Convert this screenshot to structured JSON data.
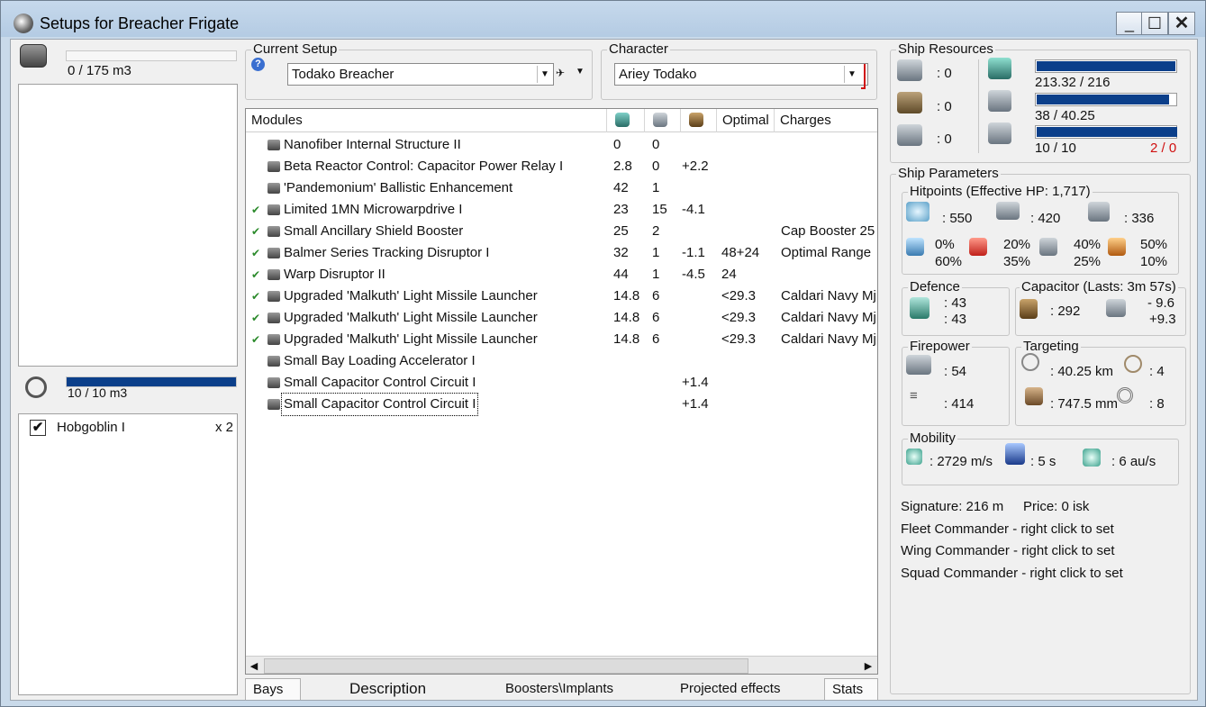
{
  "window": {
    "title": "Setups for Breacher Frigate",
    "minimize": "_",
    "maximize": "☐",
    "close": "✕"
  },
  "cargo": {
    "label": "0 / 175 m3",
    "fill": 0
  },
  "drone_bay": {
    "label": "10 / 10 m3",
    "fill": 1.0,
    "drones": [
      {
        "name": "Hobgoblin I",
        "qty": "x 2",
        "checked": "✔"
      }
    ]
  },
  "current_setup": {
    "title": "Current Setup",
    "value": "Todako Breacher",
    "help": "?"
  },
  "character": {
    "title": "Character",
    "value": "Ariey Todako"
  },
  "modules": {
    "headers": [
      "Modules",
      "",
      "",
      "",
      "Optimal",
      "Charges"
    ],
    "rows": [
      {
        "name": "Nanofiber Internal Structure II",
        "active": "",
        "c1": "0",
        "c2": "0",
        "c3": "",
        "c4": "",
        "c5": ""
      },
      {
        "name": "Beta Reactor Control: Capacitor Power Relay I",
        "active": "",
        "c1": "2.8",
        "c2": "0",
        "c3": "+2.2",
        "c4": "",
        "c5": ""
      },
      {
        "name": "'Pandemonium' Ballistic Enhancement",
        "active": "",
        "c1": "42",
        "c2": "1",
        "c3": "",
        "c4": "",
        "c5": ""
      },
      {
        "name": "Limited 1MN Microwarpdrive I",
        "active": "✔",
        "c1": "23",
        "c2": "15",
        "c3": "-4.1",
        "c4": "",
        "c5": ""
      },
      {
        "name": "Small Ancillary Shield Booster",
        "active": "✔",
        "c1": "25",
        "c2": "2",
        "c3": "",
        "c4": "",
        "c5": "Cap Booster 25"
      },
      {
        "name": "Balmer Series Tracking Disruptor I",
        "active": "✔",
        "c1": "32",
        "c2": "1",
        "c3": "-1.1",
        "c4": "48+24",
        "c5": "Optimal Range"
      },
      {
        "name": "Warp Disruptor II",
        "active": "✔",
        "c1": "44",
        "c2": "1",
        "c3": "-4.5",
        "c4": "24",
        "c5": ""
      },
      {
        "name": "Upgraded 'Malkuth' Light Missile Launcher",
        "active": "✔",
        "c1": "14.8",
        "c2": "6",
        "c3": "",
        "c4": "<29.3",
        "c5": "Caldari Navy Mj"
      },
      {
        "name": "Upgraded 'Malkuth' Light Missile Launcher",
        "active": "✔",
        "c1": "14.8",
        "c2": "6",
        "c3": "",
        "c4": "<29.3",
        "c5": "Caldari Navy Mj"
      },
      {
        "name": "Upgraded 'Malkuth' Light Missile Launcher",
        "active": "✔",
        "c1": "14.8",
        "c2": "6",
        "c3": "",
        "c4": "<29.3",
        "c5": "Caldari Navy Mj"
      },
      {
        "name": "Small Bay Loading Accelerator I",
        "active": "",
        "c1": "",
        "c2": "",
        "c3": "",
        "c4": "",
        "c5": ""
      },
      {
        "name": "Small Capacitor Control Circuit I",
        "active": "",
        "c1": "",
        "c2": "",
        "c3": "+1.4",
        "c4": "",
        "c5": ""
      },
      {
        "name": "Small Capacitor Control Circuit I",
        "active": "",
        "c1": "",
        "c2": "",
        "c3": "+1.4",
        "c4": "",
        "c5": ""
      }
    ]
  },
  "tabs": [
    "Bays",
    "Description",
    "Boosters\\Implants",
    "Projected effects",
    "Stats"
  ],
  "ship_resources": {
    "title": "Ship Resources",
    "hardpoints": [
      ": 0",
      ": 0",
      ": 0"
    ],
    "cpu": {
      "label": "213.32 / 216",
      "fill": 0.988
    },
    "powergrid": {
      "label": "38 / 40.25",
      "fill": 0.944
    },
    "calibration": {
      "label": "10 / 10",
      "fill": 1.0,
      "extra": "2 / 0"
    }
  },
  "ship_parameters": {
    "title": "Ship Parameters",
    "hitpoints": {
      "title": "Hitpoints (Effective HP: 1,717)",
      "shield": ": 550",
      "armor": ": 420",
      "structure": ": 336",
      "resists": [
        {
          "top": "0%",
          "bottom": "60%"
        },
        {
          "top": "20%",
          "bottom": "35%"
        },
        {
          "top": "40%",
          "bottom": "25%"
        },
        {
          "top": "50%",
          "bottom": "10%"
        }
      ]
    },
    "defence": {
      "title": "Defence",
      "top": ": 43",
      "bottom": ": 43"
    },
    "capacitor": {
      "title": "Capacitor (Lasts: 3m 57s)",
      "amount": ": 292",
      "delta_top": "- 9.6",
      "delta_bottom": "+9.3"
    },
    "firepower": {
      "title": "Firepower",
      "top": ": 54",
      "bottom": ": 414"
    },
    "targeting": {
      "title": "Targeting",
      "range": ": 40.25 km",
      "targets": ": 4",
      "resolution": ": 747.5 mm",
      "sensor": ": 8"
    },
    "mobility": {
      "title": "Mobility",
      "speed": ": 2729 m/s",
      "align": ": 5 s",
      "warp": ": 6 au/s"
    },
    "signature": "Signature: 216 m",
    "price": "Price: 0 isk",
    "fleet_commander": "Fleet Commander - right click to set",
    "wing_commander": "Wing Commander - right click to set",
    "squad_commander": "Squad Commander - right click to set"
  }
}
